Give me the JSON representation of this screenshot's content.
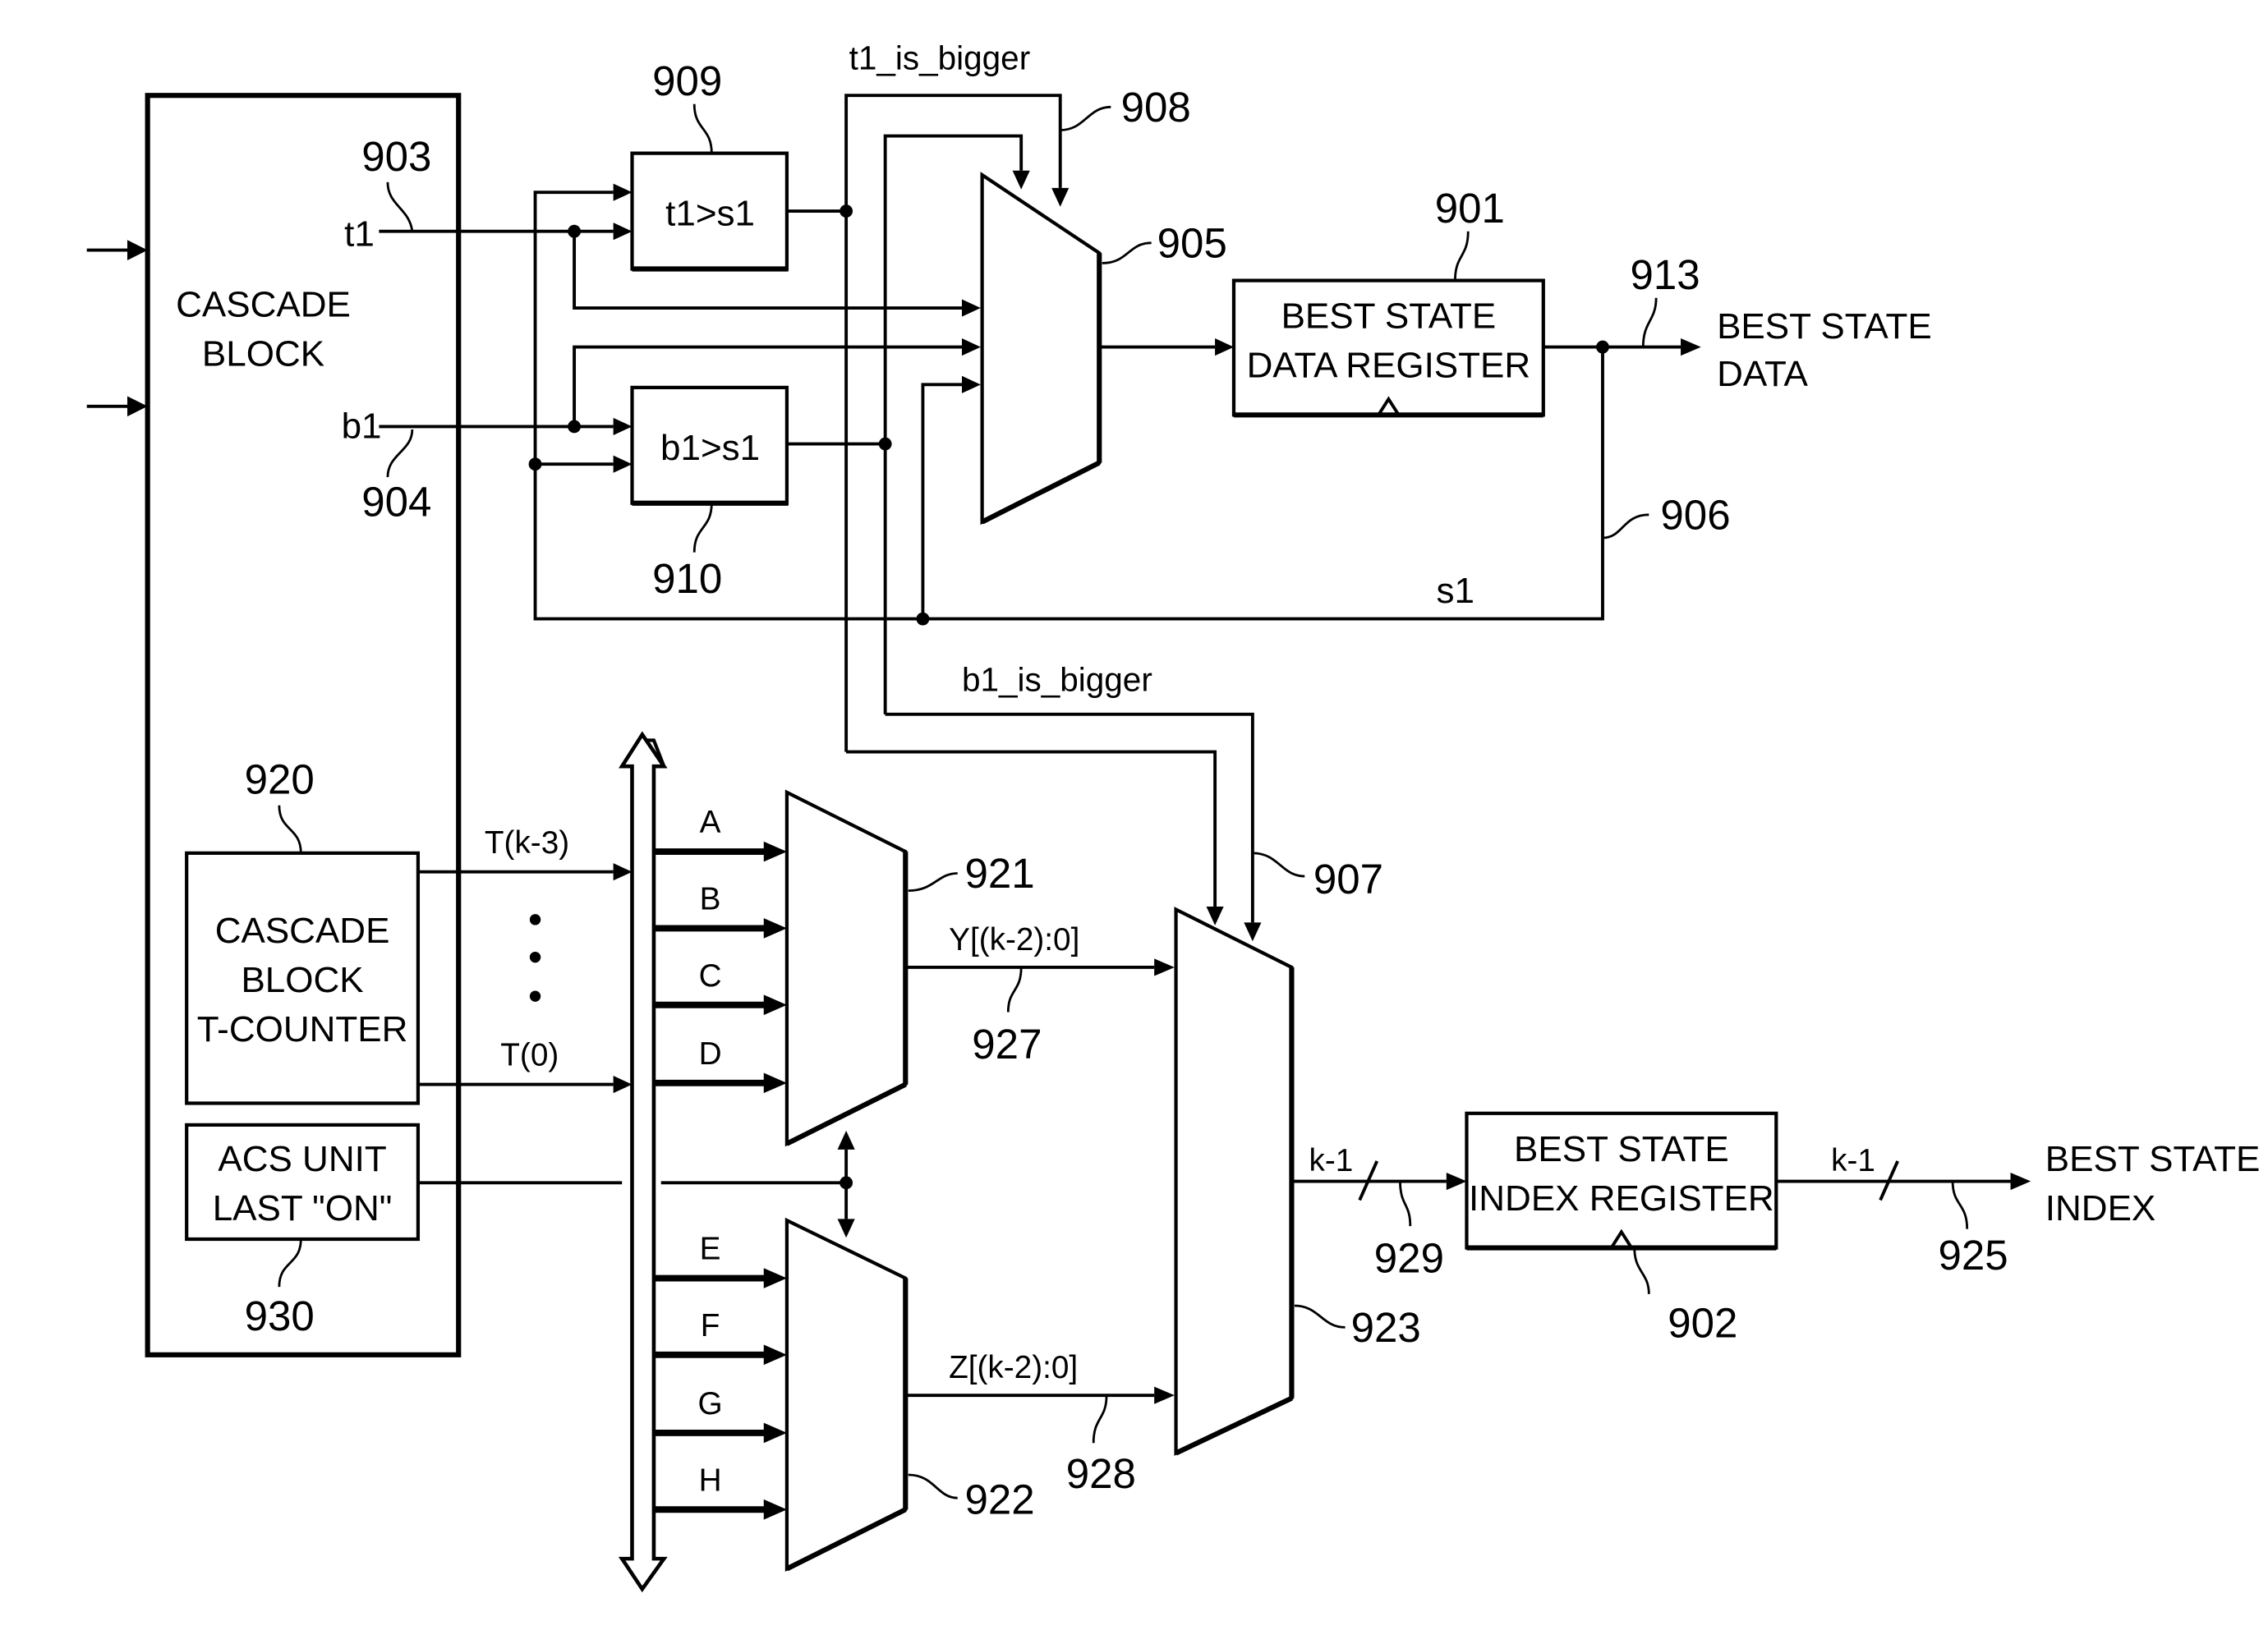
{
  "diagram": {
    "blocks": {
      "cascade_block": {
        "line1": "CASCADE",
        "line2": "BLOCK"
      },
      "cmp_t1": {
        "label": "t1>s1",
        "ref": "909"
      },
      "cmp_b1": {
        "label": "b1>s1",
        "ref": "910"
      },
      "mux_905": {
        "ref": "905"
      },
      "best_state_data_register": {
        "line1": "BEST STATE",
        "line2": "DATA REGISTER",
        "ref": "901"
      },
      "t_counter": {
        "line1": "CASCADE",
        "line2": "BLOCK",
        "line3": "T-COUNTER",
        "ref": "920"
      },
      "acs_unit": {
        "line1": "ACS UNIT",
        "line2": "LAST \"ON\"",
        "ref": "930"
      },
      "mux_921": {
        "ref": "921"
      },
      "mux_922": {
        "ref": "922"
      },
      "mux_923": {
        "ref": "923"
      },
      "best_state_index_register": {
        "line1": "BEST STATE",
        "line2": "INDEX REGISTER",
        "ref": "902"
      }
    },
    "signals": {
      "t1": "t1",
      "t1_ref": "903",
      "b1": "b1",
      "b1_ref": "904",
      "t1_is_bigger": "t1_is_bigger",
      "t1_is_bigger_ref": "908",
      "b1_is_bigger": "b1_is_bigger",
      "b1_is_bigger_ref": "907",
      "s1": "s1",
      "s1_ref": "906",
      "best_state_data_out_ref": "913",
      "best_state_data_out_line1": "BEST STATE",
      "best_state_data_out_line2": "DATA",
      "t_k3": "T(k-3)",
      "t_0": "T(0)",
      "ellipsis": "⋮",
      "y_bus": "Y[(k-2):0]",
      "y_ref": "927",
      "z_bus": "Z[(k-2):0]",
      "z_ref": "928",
      "k1_a": "k-1",
      "k1_a_ref": "929",
      "k1_b": "k-1",
      "k1_b_ref": "925",
      "best_state_index_out_line1": "BEST STATE",
      "best_state_index_out_line2": "INDEX"
    },
    "bus_inputs_upper": [
      "A",
      "B",
      "C",
      "D"
    ],
    "bus_inputs_lower": [
      "E",
      "F",
      "G",
      "H"
    ]
  }
}
